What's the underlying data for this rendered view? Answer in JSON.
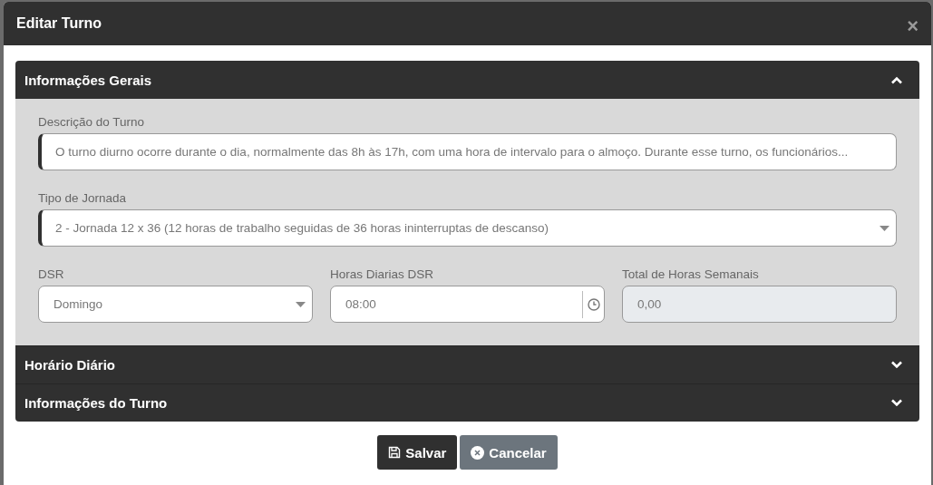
{
  "modal": {
    "title": "Editar Turno",
    "close": "×"
  },
  "sections": [
    {
      "title": "Informações Gerais",
      "expanded": true,
      "rows": [
        [
          {
            "kind": "text",
            "label": "Descrição do Turno",
            "value": "O turno diurno ocorre durante o dia, normalmente das 8h às 17h, com uma hora de intervalo para o almoço. Durante esse turno, os funcionários...",
            "required": true
          }
        ],
        [
          {
            "kind": "select",
            "label": "Tipo de Jornada",
            "value": "2 - Jornada 12 x 36 (12 horas de trabalho seguidas de 36 horas ininterruptas de descanso)",
            "required": true
          }
        ],
        [
          {
            "kind": "select",
            "label": "DSR",
            "value": "Domingo",
            "required": false
          },
          {
            "kind": "time",
            "label": "Horas Diarias DSR",
            "value": "08:00",
            "required": false
          },
          {
            "kind": "readonly",
            "label": "Total de Horas Semanais",
            "value": "0,00",
            "required": false
          }
        ]
      ]
    },
    {
      "title": "Horário Diário",
      "expanded": false
    },
    {
      "title": "Informações do Turno",
      "expanded": false
    }
  ],
  "buttons": [
    {
      "kind": "save",
      "label": "Salvar"
    },
    {
      "kind": "cancel",
      "label": "Cancelar"
    }
  ]
}
